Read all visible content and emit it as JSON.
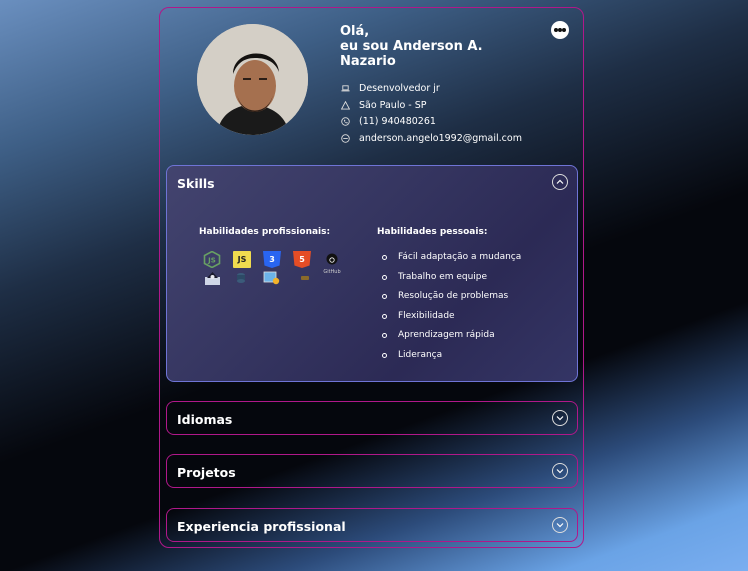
{
  "profile": {
    "greeting_line1": "Olá,",
    "greeting_line2": "eu sou Anderson A.",
    "greeting_line3": "Nazario",
    "role": "Desenvolvedor jr",
    "location": "São Paulo - SP",
    "phone": "(11) 940480261",
    "email": "anderson.angelo1992@gmail.com"
  },
  "skills": {
    "title": "Skills",
    "professional_heading": "Habilidades profissionais:",
    "personal_heading": "Habilidades pessoais:",
    "tech_icons": [
      "nodejs-icon",
      "javascript-icon",
      "css3-icon",
      "html5-icon",
      "github-icon",
      "hacker-icon",
      "database-icon",
      "vscode-icon",
      "small-logo-icon"
    ],
    "tech_labels": {
      "js": "JS",
      "css": "3",
      "html": "5",
      "github": "GitHub"
    },
    "personal": [
      "Fácil adaptação a mudança",
      "Trabalho em equipe",
      "Resolução de problemas",
      "Flexibilidade",
      "Aprendizagem rápida",
      "Liderança"
    ]
  },
  "sections": {
    "idiomas": "Idiomas",
    "projetos": "Projetos",
    "experiencia": "Experiencia profissional"
  },
  "colors": {
    "border": "#b0188a",
    "open_panel_border": "#6f74d6",
    "js_yellow": "#f0db4f",
    "css_blue": "#2965f1",
    "html_orange": "#e44d26",
    "node_green": "#68a063"
  }
}
